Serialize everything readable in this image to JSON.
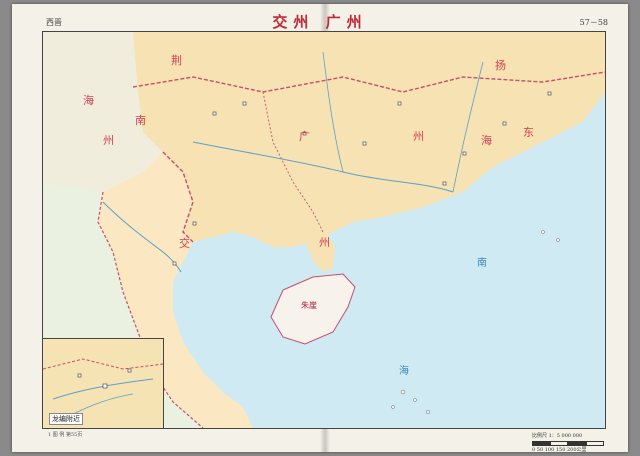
{
  "header": {
    "dynasty": "西晋",
    "title": "交州 广州",
    "page_numbers": "57－58"
  },
  "regions": [
    {
      "id": "yizhou",
      "label": "州"
    },
    {
      "id": "jiaozhou",
      "label": "交"
    },
    {
      "id": "guangzhou-guang",
      "label": "广"
    },
    {
      "id": "guangzhou-zhou",
      "label": "州"
    },
    {
      "id": "jingzhou",
      "label": "荆"
    },
    {
      "id": "yangzhou",
      "label": "扬"
    },
    {
      "id": "zhou-qiong",
      "label": "州"
    },
    {
      "id": "nan",
      "label": "南"
    },
    {
      "id": "zhuya",
      "label": "朱崖"
    },
    {
      "id": "hai",
      "label": "海"
    },
    {
      "id": "dong",
      "label": "东"
    },
    {
      "id": "hai-left",
      "label": "海"
    }
  ],
  "seas": [
    {
      "id": "south-sea-nan",
      "label": "南"
    },
    {
      "id": "south-sea-hai",
      "label": "海"
    }
  ],
  "inset": {
    "title": "龙编附近"
  },
  "scale": {
    "label": "比例尺 1：5 000 000",
    "ticks": "0   50   100   150   200公里"
  },
  "footer_note": "1  图 例 第55页",
  "colors": {
    "sea": "#cfeaf3",
    "land_guang": "#f7e2b4",
    "land_jiao": "#fbe8c2",
    "land_outer": "#eaf1e0",
    "border": "#c84d6b",
    "river": "#5aa0c8"
  }
}
